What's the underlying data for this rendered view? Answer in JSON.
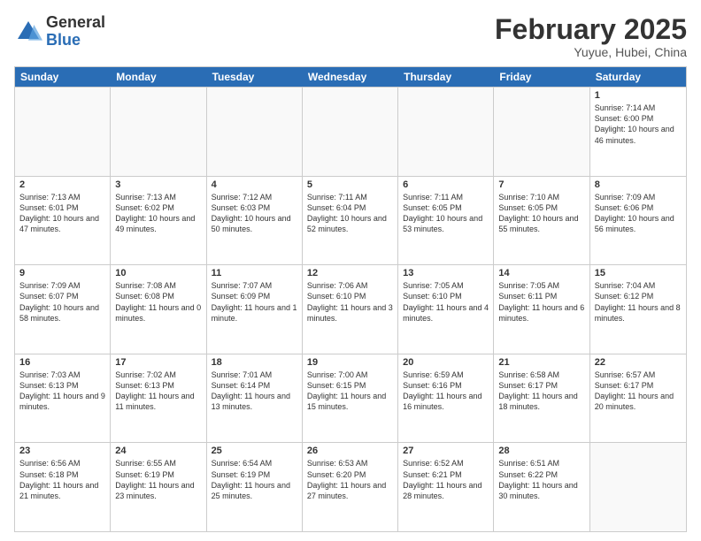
{
  "logo": {
    "general": "General",
    "blue": "Blue"
  },
  "title": {
    "month_year": "February 2025",
    "location": "Yuyue, Hubei, China"
  },
  "weekdays": [
    "Sunday",
    "Monday",
    "Tuesday",
    "Wednesday",
    "Thursday",
    "Friday",
    "Saturday"
  ],
  "rows": [
    [
      {
        "day": "",
        "info": ""
      },
      {
        "day": "",
        "info": ""
      },
      {
        "day": "",
        "info": ""
      },
      {
        "day": "",
        "info": ""
      },
      {
        "day": "",
        "info": ""
      },
      {
        "day": "",
        "info": ""
      },
      {
        "day": "1",
        "info": "Sunrise: 7:14 AM\nSunset: 6:00 PM\nDaylight: 10 hours and 46 minutes."
      }
    ],
    [
      {
        "day": "2",
        "info": "Sunrise: 7:13 AM\nSunset: 6:01 PM\nDaylight: 10 hours and 47 minutes."
      },
      {
        "day": "3",
        "info": "Sunrise: 7:13 AM\nSunset: 6:02 PM\nDaylight: 10 hours and 49 minutes."
      },
      {
        "day": "4",
        "info": "Sunrise: 7:12 AM\nSunset: 6:03 PM\nDaylight: 10 hours and 50 minutes."
      },
      {
        "day": "5",
        "info": "Sunrise: 7:11 AM\nSunset: 6:04 PM\nDaylight: 10 hours and 52 minutes."
      },
      {
        "day": "6",
        "info": "Sunrise: 7:11 AM\nSunset: 6:05 PM\nDaylight: 10 hours and 53 minutes."
      },
      {
        "day": "7",
        "info": "Sunrise: 7:10 AM\nSunset: 6:05 PM\nDaylight: 10 hours and 55 minutes."
      },
      {
        "day": "8",
        "info": "Sunrise: 7:09 AM\nSunset: 6:06 PM\nDaylight: 10 hours and 56 minutes."
      }
    ],
    [
      {
        "day": "9",
        "info": "Sunrise: 7:09 AM\nSunset: 6:07 PM\nDaylight: 10 hours and 58 minutes."
      },
      {
        "day": "10",
        "info": "Sunrise: 7:08 AM\nSunset: 6:08 PM\nDaylight: 11 hours and 0 minutes."
      },
      {
        "day": "11",
        "info": "Sunrise: 7:07 AM\nSunset: 6:09 PM\nDaylight: 11 hours and 1 minute."
      },
      {
        "day": "12",
        "info": "Sunrise: 7:06 AM\nSunset: 6:10 PM\nDaylight: 11 hours and 3 minutes."
      },
      {
        "day": "13",
        "info": "Sunrise: 7:05 AM\nSunset: 6:10 PM\nDaylight: 11 hours and 4 minutes."
      },
      {
        "day": "14",
        "info": "Sunrise: 7:05 AM\nSunset: 6:11 PM\nDaylight: 11 hours and 6 minutes."
      },
      {
        "day": "15",
        "info": "Sunrise: 7:04 AM\nSunset: 6:12 PM\nDaylight: 11 hours and 8 minutes."
      }
    ],
    [
      {
        "day": "16",
        "info": "Sunrise: 7:03 AM\nSunset: 6:13 PM\nDaylight: 11 hours and 9 minutes."
      },
      {
        "day": "17",
        "info": "Sunrise: 7:02 AM\nSunset: 6:13 PM\nDaylight: 11 hours and 11 minutes."
      },
      {
        "day": "18",
        "info": "Sunrise: 7:01 AM\nSunset: 6:14 PM\nDaylight: 11 hours and 13 minutes."
      },
      {
        "day": "19",
        "info": "Sunrise: 7:00 AM\nSunset: 6:15 PM\nDaylight: 11 hours and 15 minutes."
      },
      {
        "day": "20",
        "info": "Sunrise: 6:59 AM\nSunset: 6:16 PM\nDaylight: 11 hours and 16 minutes."
      },
      {
        "day": "21",
        "info": "Sunrise: 6:58 AM\nSunset: 6:17 PM\nDaylight: 11 hours and 18 minutes."
      },
      {
        "day": "22",
        "info": "Sunrise: 6:57 AM\nSunset: 6:17 PM\nDaylight: 11 hours and 20 minutes."
      }
    ],
    [
      {
        "day": "23",
        "info": "Sunrise: 6:56 AM\nSunset: 6:18 PM\nDaylight: 11 hours and 21 minutes."
      },
      {
        "day": "24",
        "info": "Sunrise: 6:55 AM\nSunset: 6:19 PM\nDaylight: 11 hours and 23 minutes."
      },
      {
        "day": "25",
        "info": "Sunrise: 6:54 AM\nSunset: 6:19 PM\nDaylight: 11 hours and 25 minutes."
      },
      {
        "day": "26",
        "info": "Sunrise: 6:53 AM\nSunset: 6:20 PM\nDaylight: 11 hours and 27 minutes."
      },
      {
        "day": "27",
        "info": "Sunrise: 6:52 AM\nSunset: 6:21 PM\nDaylight: 11 hours and 28 minutes."
      },
      {
        "day": "28",
        "info": "Sunrise: 6:51 AM\nSunset: 6:22 PM\nDaylight: 11 hours and 30 minutes."
      },
      {
        "day": "",
        "info": ""
      }
    ]
  ]
}
